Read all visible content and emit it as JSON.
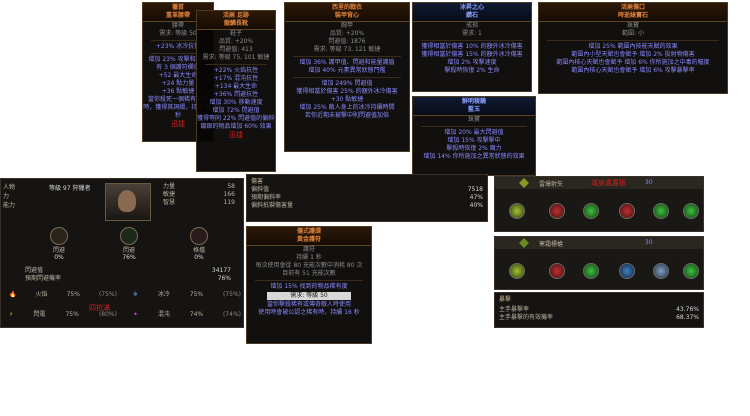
{
  "belt": {
    "title": "獵首",
    "name": "重革腰帶",
    "lines": [
      "腰帶",
      "需求: 等級 50",
      "+23% 冰冷抗性",
      "增加 23% 攻擊和施法",
      "有 3 個護符欄位",
      "+52 最大生命",
      "+24 點力量",
      "+36 點敏捷",
      "當你殺死一個稀有怪物時，獲得其詞綴，持續 60 秒"
    ],
    "label": "迅捷"
  },
  "boots": {
    "title": "活屍 足跡",
    "name": "龍鱗長靴",
    "lines": [
      "鞋子",
      "品質: +20%",
      "閃避值: 413",
      "需求: 等級 75, 101 敏捷",
      "+22% 火焰抗性",
      "+17% 混沌抗性",
      "+134 最大生命",
      "+36% 閃避抗性",
      "增加 30% 移動速度",
      "增加 72% 閃避值",
      "獲得等同 22% 閃避值的偏斜值",
      "鍍銀的物品增加 60% 效果"
    ],
    "label": "迅捷"
  },
  "body": {
    "title": "西里的戰衣",
    "name": "裝甲背心",
    "lines": [
      "胸甲",
      "品質: +20%",
      "閃避值: 1876",
      "需求: 等級 73, 121 敏捷",
      "增加 36% 護甲值、閃避和能量護盾",
      "增加 40% 元素異常狀態門檻",
      "增加 249% 閃避值",
      "獲得相當於傷害 25% 的額外冰冷傷害",
      "+30 點敏捷",
      "增加 25% 敵人身上的冰冷持續時間",
      "若你近期未被擊中則閃避值加倍"
    ]
  },
  "ring": {
    "title": "冰昇之心",
    "name": "鑽石",
    "lines": [
      "戒指",
      "需求: 1",
      "獲得相當於傷害 10% 的額外冰冷傷害",
      "獲得相當於傷害 15% 的額外冰冷傷害",
      "增加 2% 攻擊速度",
      "擊殺時恢復 2% 生命"
    ]
  },
  "jewel1": {
    "title": "鮮明稜鏡",
    "name": "藍玉",
    "lines": [
      "珠寶",
      "增加 20% 最大閃避值",
      "增加 15% 攻擊擊中",
      "擊殺時恢復 2% 魔力",
      "增加 14% 你所施加之異常狀態的效果"
    ]
  },
  "jewel2": {
    "title": "活屍傷口",
    "name": "時逝綠寶石",
    "lines": [
      "珠寶",
      "範圍: 小",
      "增加 25% 範圍內技能天賦的效果",
      "範圍內小型天賦也會賦予 增加 2% 投射物傷害",
      "範圍內核心天賦也會賦予 增加 6% 你所施加之中毒的幅度",
      "範圍內核心天賦也會賦予 增加 6% 攻擊暴擊率"
    ]
  },
  "character": {
    "level_line": "等級 97 狩獵者",
    "stats": [
      {
        "label": "力量",
        "value": "58"
      },
      {
        "label": "敏捷",
        "value": "166"
      },
      {
        "label": "智慧",
        "value": "119"
      }
    ],
    "side": [
      "人物",
      "力",
      "能力"
    ]
  },
  "attack": {
    "title": "傷害",
    "rows": [
      {
        "label": "偏斜值",
        "value": "7518"
      },
      {
        "label": "預期偏斜率",
        "value": "47%"
      },
      {
        "label": "偏斜抵禦傷害量",
        "value": "40%"
      }
    ]
  },
  "defense": {
    "orbs": [
      {
        "label": "閃避",
        "value": "0%"
      },
      {
        "label": "閃避",
        "value": "76%"
      },
      {
        "label": "格擋",
        "value": "0%"
      }
    ],
    "rows": [
      {
        "label": "閃避值",
        "value": "34177"
      },
      {
        "label": "預期閃避機率",
        "value": "76%"
      }
    ],
    "res": [
      {
        "label": "火焰",
        "value": "75%",
        "cap": "(75%)"
      },
      {
        "label": "冰冷",
        "value": "75%",
        "cap": "(75%)"
      },
      {
        "label": "閃電",
        "value": "75%",
        "cap": "(80%)"
      },
      {
        "label": "混沌",
        "value": "74%",
        "cap": "(74%)"
      }
    ],
    "label": "四抗滿"
  },
  "amulet": {
    "title": "傷式護環",
    "name": "黃金護符",
    "lines": [
      "護符",
      "持續 1 秒",
      "每次使用會從 80 充能次數中消耗 80 次",
      "目前有 51 充能次數",
      "增加 15% 找到的物品稀有度",
      "需求: 等級 50",
      "當你擊殺稀有或傳奇敵人時使用",
      "使用時會被公認之稀有時，持續 16 秒"
    ]
  },
  "skills": {
    "row1_name": "雷爆射矢",
    "row1_label": "減身處置板",
    "row1_level": "30",
    "row2_name": "寒霜標槍",
    "row2_level": "30",
    "crit_title": "暴擊",
    "crit_rows": [
      {
        "label": "主手暴擊率",
        "value": "43.76%"
      },
      {
        "label": "主手暴擊的有效機率",
        "value": "68.37%"
      }
    ]
  }
}
